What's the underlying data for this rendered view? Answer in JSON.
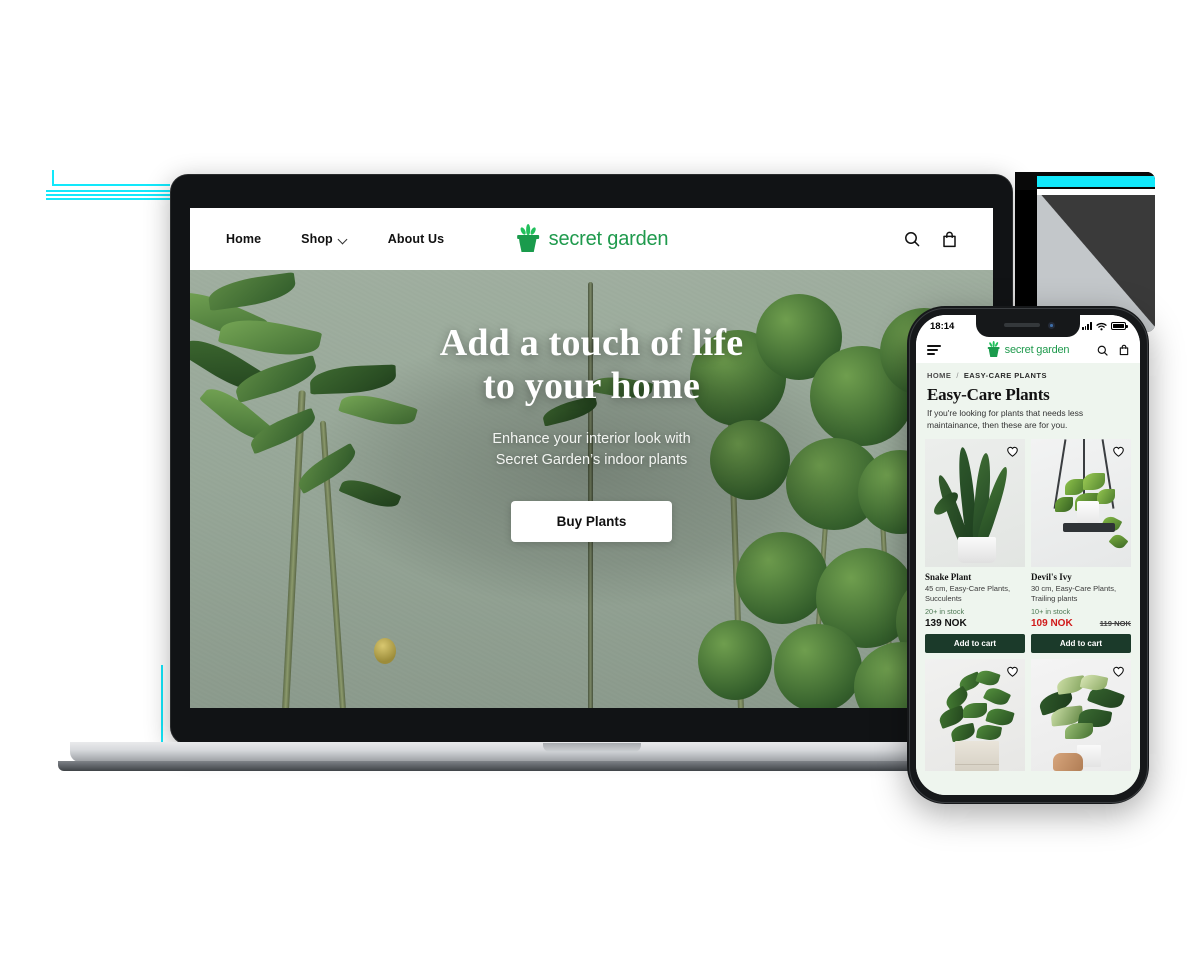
{
  "desktop": {
    "nav": [
      {
        "label": "Home",
        "has_chevron": false
      },
      {
        "label": "Shop",
        "has_chevron": true
      },
      {
        "label": "About Us",
        "has_chevron": false
      }
    ],
    "brand": "secret garden",
    "icons": {
      "search": "search-icon",
      "bag": "shopping-bag-icon"
    },
    "hero": {
      "title_line1": "Add a touch of life",
      "title_line2": "to your home",
      "subtitle_line1": "Enhance your interior look with",
      "subtitle_line2": "Secret Garden’s indoor plants",
      "cta": "Buy Plants"
    }
  },
  "phone": {
    "status": {
      "time": "18:14",
      "signal": "cellular-icon",
      "wifi": "wifi-icon",
      "battery": "battery-icon"
    },
    "brand": "secret garden",
    "icons": {
      "menu": "hamburger-icon",
      "search": "search-icon",
      "bag": "shopping-bag-icon"
    },
    "breadcrumb": {
      "home": "HOME",
      "separator": "/",
      "current": "EASY-CARE PLANTS"
    },
    "page_title": "Easy-Care Plants",
    "page_description": "If you're looking for plants that needs less maintainance, then these are for you.",
    "products": [
      {
        "name": "Snake Plant",
        "meta": "45 cm, Easy-Care Plants, Succulents",
        "stock": "20+ in stock",
        "price": "139 NOK",
        "old_price": "",
        "on_sale": false,
        "cta": "Add to cart",
        "image": "snake-plant-photo"
      },
      {
        "name": "Devil's Ivy",
        "meta": "30 cm, Easy-Care Plants, Trailing plants",
        "stock": "10+ in stock",
        "price": "109 NOK",
        "old_price": "119 NOK",
        "on_sale": true,
        "cta": "Add to cart",
        "image": "devils-ivy-hanging-photo"
      },
      {
        "name": "",
        "meta": "",
        "stock": "",
        "price": "",
        "old_price": "",
        "on_sale": false,
        "cta": "",
        "image": "potted-green-plant-photo"
      },
      {
        "name": "",
        "meta": "",
        "stock": "",
        "price": "",
        "old_price": "",
        "on_sale": false,
        "cta": "",
        "image": "variegated-plant-held-photo"
      }
    ]
  },
  "colors": {
    "brand_green": "#1f9a4d",
    "logo_green": "#1a9b4c",
    "dark_green_button": "#1b3a2a",
    "sale_red": "#d01919",
    "stock_green": "#4e7a55",
    "phone_bg": "#eef5ee",
    "hero_wall": "#97a798",
    "cyan_artifact": "#12e8fb",
    "laptop_body": "#111315",
    "laptop_base": "#b9bcc0"
  }
}
